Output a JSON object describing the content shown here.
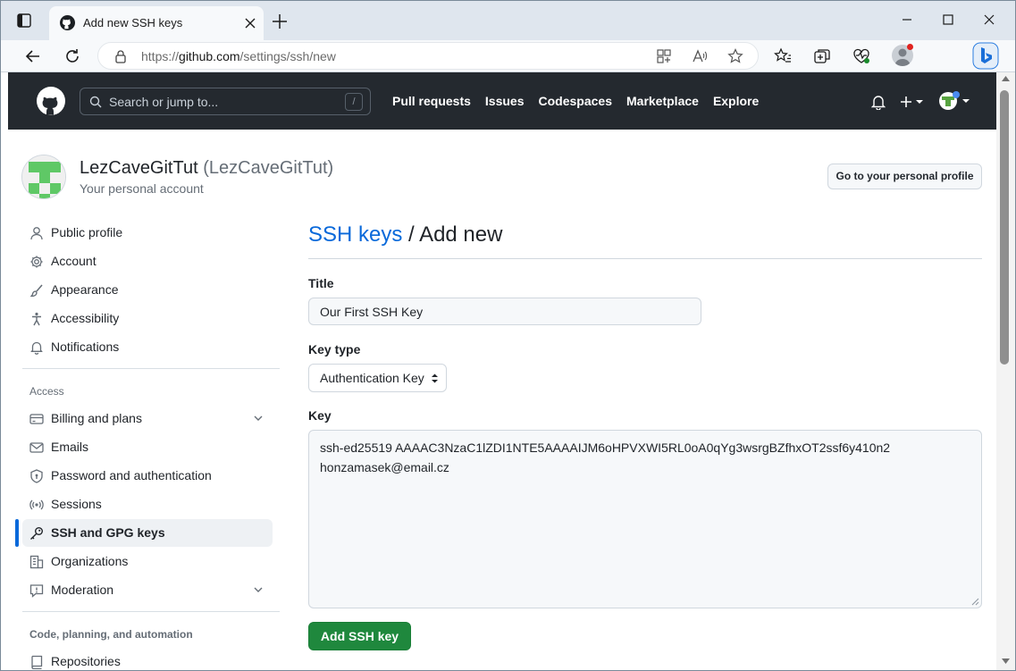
{
  "browser": {
    "tab_title": "Add new SSH keys",
    "url_prefix": "https://",
    "url_host": "github.com",
    "url_path": "/settings/ssh/new"
  },
  "github_header": {
    "search_placeholder": "Search or jump to...",
    "search_shortcut": "/",
    "nav": [
      "Pull requests",
      "Issues",
      "Codespaces",
      "Marketplace",
      "Explore"
    ]
  },
  "account": {
    "display_name": "LezCaveGitTut",
    "login": "(LezCaveGitTut)",
    "subtitle": "Your personal account",
    "profile_button": "Go to your personal profile"
  },
  "sidebar": {
    "items_top": [
      {
        "label": "Public profile",
        "icon": "person-icon"
      },
      {
        "label": "Account",
        "icon": "gear-icon"
      },
      {
        "label": "Appearance",
        "icon": "paintbrush-icon"
      },
      {
        "label": "Accessibility",
        "icon": "accessibility-icon"
      },
      {
        "label": "Notifications",
        "icon": "bell-icon"
      }
    ],
    "access_heading": "Access",
    "items_access": [
      {
        "label": "Billing and plans",
        "icon": "credit-card-icon",
        "expandable": true
      },
      {
        "label": "Emails",
        "icon": "mail-icon"
      },
      {
        "label": "Password and authentication",
        "icon": "shield-lock-icon"
      },
      {
        "label": "Sessions",
        "icon": "broadcast-icon"
      },
      {
        "label": "SSH and GPG keys",
        "icon": "key-icon",
        "active": true
      },
      {
        "label": "Organizations",
        "icon": "organization-icon"
      },
      {
        "label": "Moderation",
        "icon": "report-icon",
        "expandable": true
      }
    ],
    "code_heading": "Code, planning, and automation",
    "items_code": [
      {
        "label": "Repositories",
        "icon": "repo-icon"
      }
    ]
  },
  "form": {
    "breadcrumb_link": "SSH keys",
    "breadcrumb_sep": " / ",
    "breadcrumb_current": "Add new",
    "title_label": "Title",
    "title_value": "Our First SSH Key",
    "key_type_label": "Key type",
    "key_type_value": "Authentication Key",
    "key_label": "Key",
    "key_line1": "ssh-ed25519 AAAAC3NzaC1lZDI1NTE5AAAAIJM6oHPVXWI5RL0oA0qYg3wsrgBZfhxOT2ssf6y410n2",
    "key_line2": "honzamasek@email.cz",
    "submit_label": "Add SSH key"
  },
  "colors": {
    "accent": "#0969da",
    "header_bg": "#24292f",
    "primary_button": "#1f883d"
  }
}
